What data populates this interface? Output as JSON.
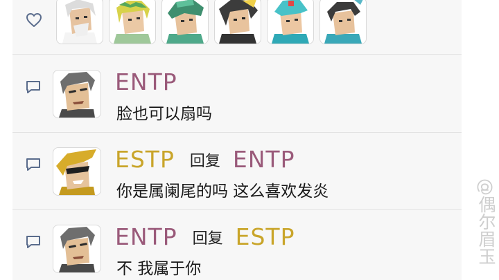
{
  "likes": {
    "icon": "heart-icon",
    "avatars": [
      "avatar-white-hair",
      "avatar-green-wreath",
      "avatar-green-hat",
      "avatar-dark-hair",
      "avatar-teal-cap",
      "avatar-dark-crown"
    ]
  },
  "comments": [
    {
      "icon": "comment-icon",
      "avatar": "avatar-gray-hair",
      "author": "ENTP",
      "reply_word": "",
      "reply_to": "",
      "text": "脸也可以扇吗"
    },
    {
      "icon": "comment-icon",
      "avatar": "avatar-sunglasses",
      "author": "ESTP",
      "reply_word": "回复",
      "reply_to": "ENTP",
      "text": "你是属阑尾的吗 这么喜欢发炎"
    },
    {
      "icon": "comment-icon",
      "avatar": "avatar-gray-hair",
      "author": "ENTP",
      "reply_word": "回复",
      "reply_to": "ESTP",
      "text": "不 我属于你"
    }
  ],
  "watermark": "@偶尔眉玉",
  "colors": {
    "entp": "#9a5a7a",
    "estp": "#c9a52a",
    "panel": "#f7f7f7",
    "divider": "#e2e2e2"
  }
}
